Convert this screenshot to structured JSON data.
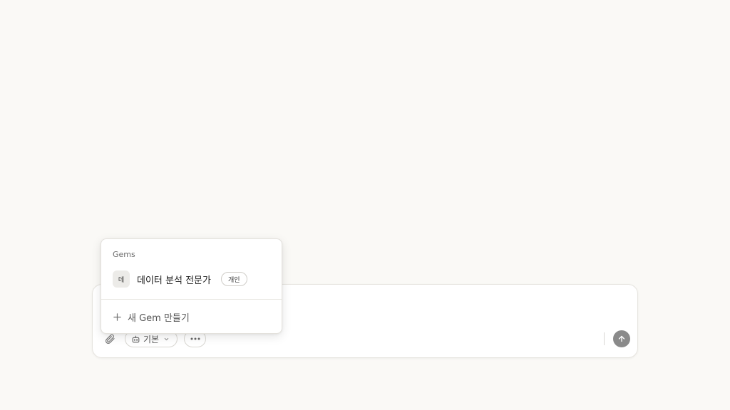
{
  "gems_menu": {
    "heading": "Gems",
    "items": [
      {
        "avatar": "데",
        "name": "데이터 분석 전문가",
        "badge": "개인"
      }
    ],
    "new_gem_label": "새 Gem 만들기"
  },
  "composer": {
    "model_label": "기본",
    "icons": {
      "attach": "paperclip-icon",
      "model": "robot-icon",
      "chevron": "chevron-down-icon",
      "more": "ellipsis-icon",
      "send": "arrow-up-icon"
    }
  }
}
